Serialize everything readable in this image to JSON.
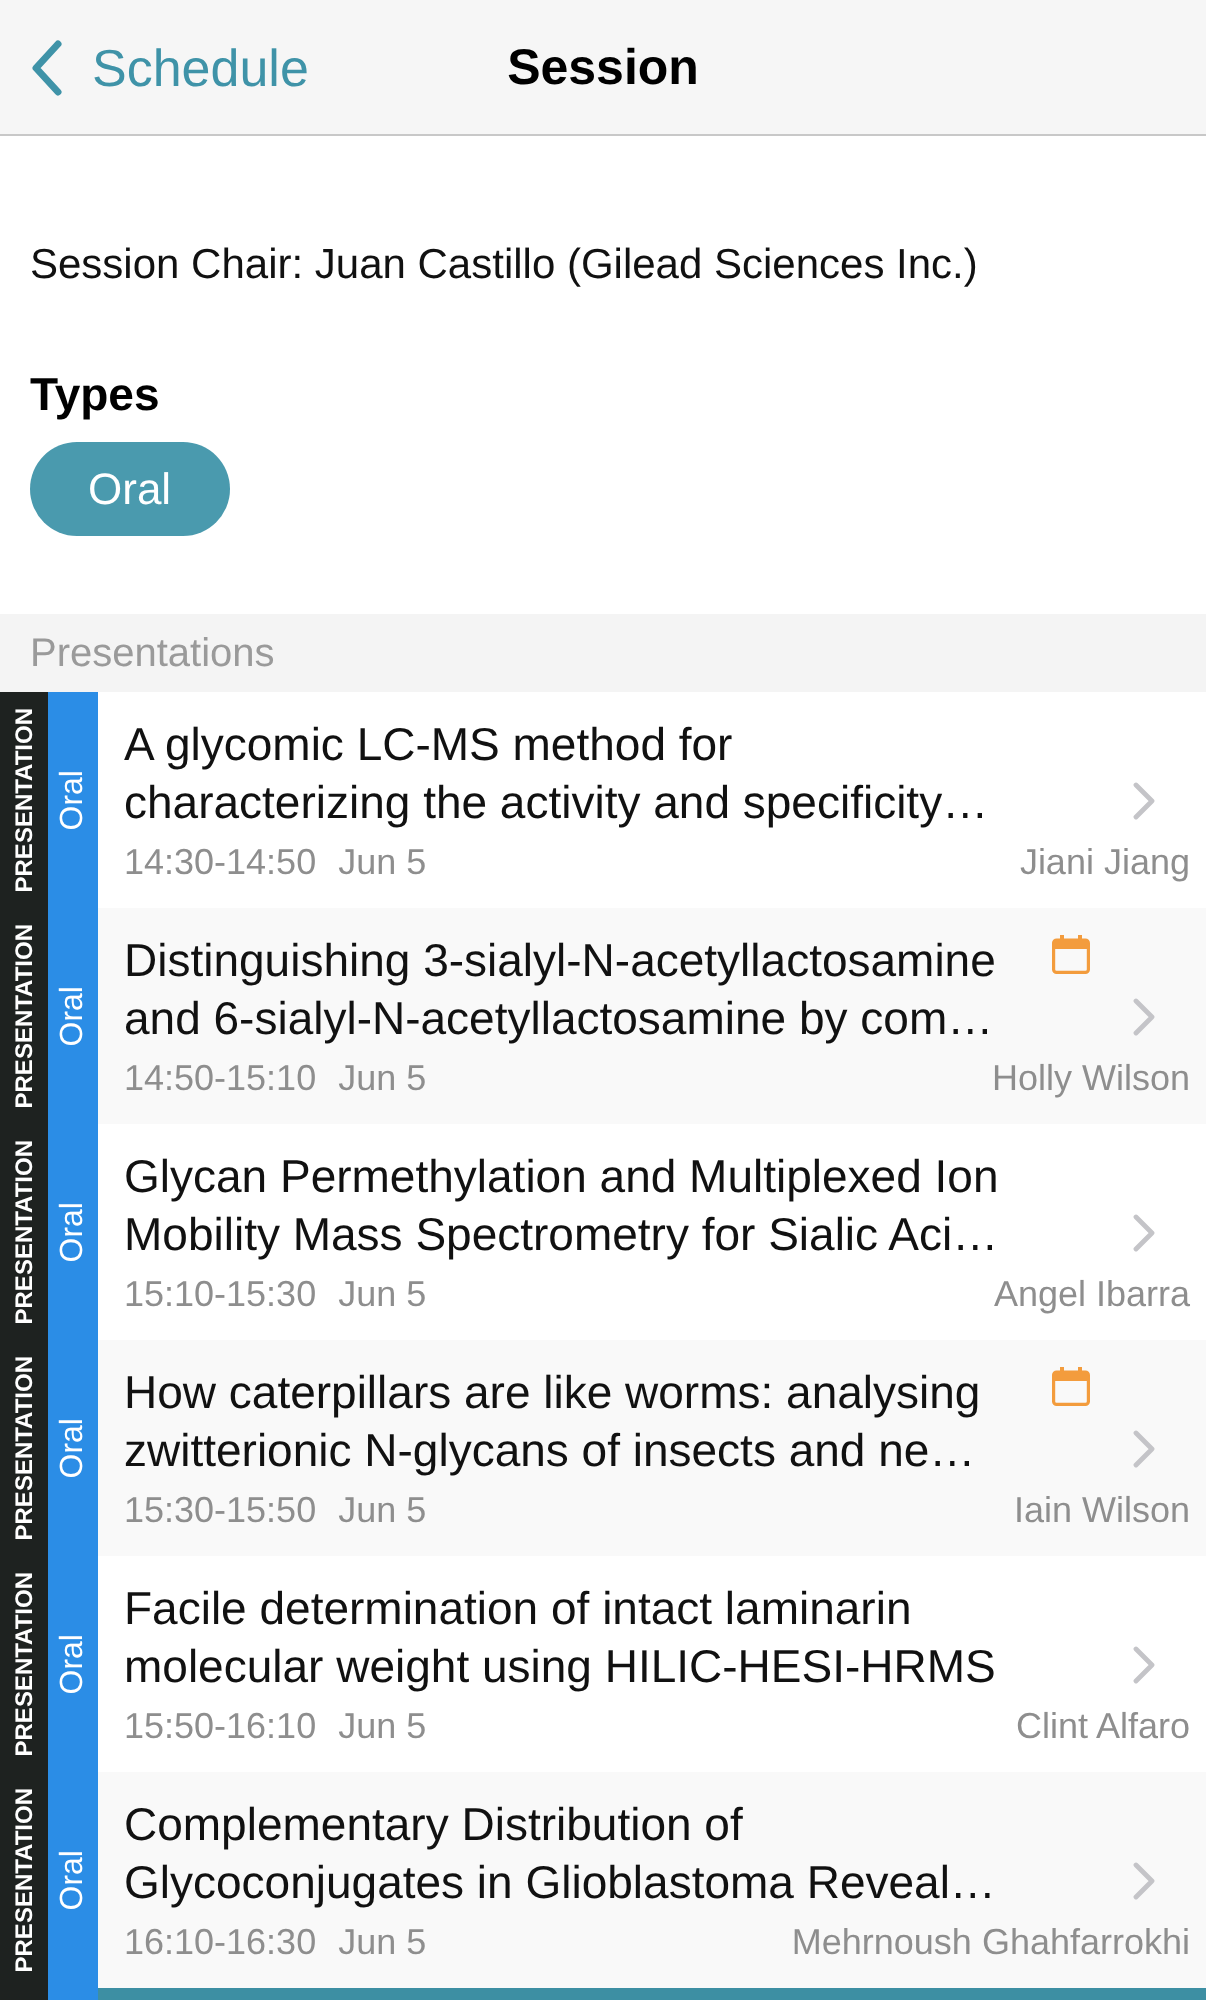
{
  "header": {
    "back_label": "Schedule",
    "title": "Session"
  },
  "session": {
    "chair": "Session Chair: Juan Castillo (Gilead Sciences Inc.)",
    "types_heading": "Types",
    "types": [
      "Oral"
    ]
  },
  "presentations": {
    "heading": "Presentations",
    "items": [
      {
        "category": "PRESENTATION",
        "type": "Oral",
        "title": "A glycomic LC-MS method for\ncharacterizing the activity and specificity…",
        "time": "14:30-14:50",
        "date": "Jun 5",
        "speaker": "Jiani Jiang",
        "in_calendar": false
      },
      {
        "category": "PRESENTATION",
        "type": "Oral",
        "title": "Distinguishing 3-sialyl-N-acetyllactosamine\nand 6-sialyl-N-acetyllactosamine by com…",
        "time": "14:50-15:10",
        "date": "Jun 5",
        "speaker": "Holly Wilson",
        "in_calendar": true
      },
      {
        "category": "PRESENTATION",
        "type": "Oral",
        "title": "Glycan Permethylation and Multiplexed Ion\nMobility Mass Spectrometry for Sialic Aci…",
        "time": "15:10-15:30",
        "date": "Jun 5",
        "speaker": "Angel Ibarra",
        "in_calendar": false
      },
      {
        "category": "PRESENTATION",
        "type": "Oral",
        "title": "How caterpillars are like worms: analysing\nzwitterionic N-glycans of insects and ne…",
        "time": "15:30-15:50",
        "date": "Jun 5",
        "speaker": "Iain Wilson",
        "in_calendar": true
      },
      {
        "category": "PRESENTATION",
        "type": "Oral",
        "title": "Facile determination of intact laminarin\nmolecular weight using HILIC-HESI-HRMS",
        "time": "15:50-16:10",
        "date": "Jun 5",
        "speaker": "Clint Alfaro",
        "in_calendar": false
      },
      {
        "category": "PRESENTATION",
        "type": "Oral",
        "title": "Complementary Distribution of\nGlycoconjugates in Glioblastoma Reveal…",
        "time": "16:10-16:30",
        "date": "Jun 5",
        "speaker": "Mehrnoush Ghahfarrokhi",
        "in_calendar": false
      }
    ]
  }
}
